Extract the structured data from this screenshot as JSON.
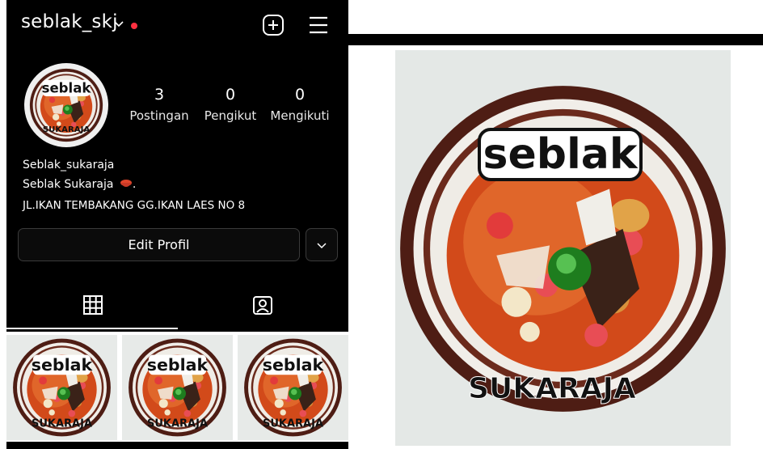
{
  "header": {
    "username": "seblak_skj",
    "notification_color": "#ff3040"
  },
  "profile": {
    "stats": [
      {
        "value": "3",
        "label": "Postingan"
      },
      {
        "value": "0",
        "label": "Pengikut"
      },
      {
        "value": "0",
        "label": "Mengikuti"
      }
    ],
    "bio": {
      "name": "Seblak_sukaraja",
      "line2": "Seblak Sukaraja",
      "address": "JL.IKAN TEMBAKANG GG.IKAN LAES NO 8"
    },
    "edit_button_label": "Edit Profil"
  },
  "tabs": [
    {
      "icon": "grid-icon",
      "active": true
    },
    {
      "icon": "tagged-icon",
      "active": false
    }
  ],
  "logo": {
    "title": "seblak",
    "subtitle": "SUKARAJA"
  },
  "colors": {
    "background": "#000000",
    "broth": "#d9501f",
    "bowl_rim": "#5a2418",
    "lime": "#2f9a2f"
  }
}
